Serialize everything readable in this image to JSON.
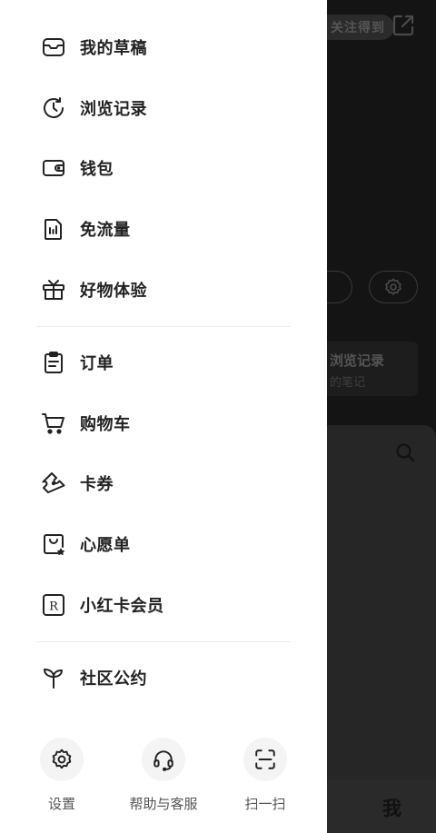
{
  "background": {
    "badge": "关注得到",
    "card_title": "浏览记录",
    "card_sub": "的笔记",
    "tab_me": "我"
  },
  "menu": {
    "group1": [
      {
        "label": "我的草稿",
        "icon": "inbox-icon"
      },
      {
        "label": "浏览记录",
        "icon": "history-clock-icon"
      },
      {
        "label": "钱包",
        "icon": "wallet-icon"
      },
      {
        "label": "免流量",
        "icon": "data-sim-icon"
      },
      {
        "label": "好物体验",
        "icon": "gift-icon"
      }
    ],
    "group2": [
      {
        "label": "订单",
        "icon": "clipboard-icon"
      },
      {
        "label": "购物车",
        "icon": "cart-icon"
      },
      {
        "label": "卡券",
        "icon": "ticket-icon"
      },
      {
        "label": "心愿单",
        "icon": "wishlist-bag-icon"
      },
      {
        "label": "小红卡会员",
        "icon": "r-card-icon"
      }
    ],
    "group3": [
      {
        "label": "社区公约",
        "icon": "sprout-icon"
      }
    ]
  },
  "bottom": {
    "settings": "设置",
    "help": "帮助与客服",
    "scan": "扫一扫"
  }
}
